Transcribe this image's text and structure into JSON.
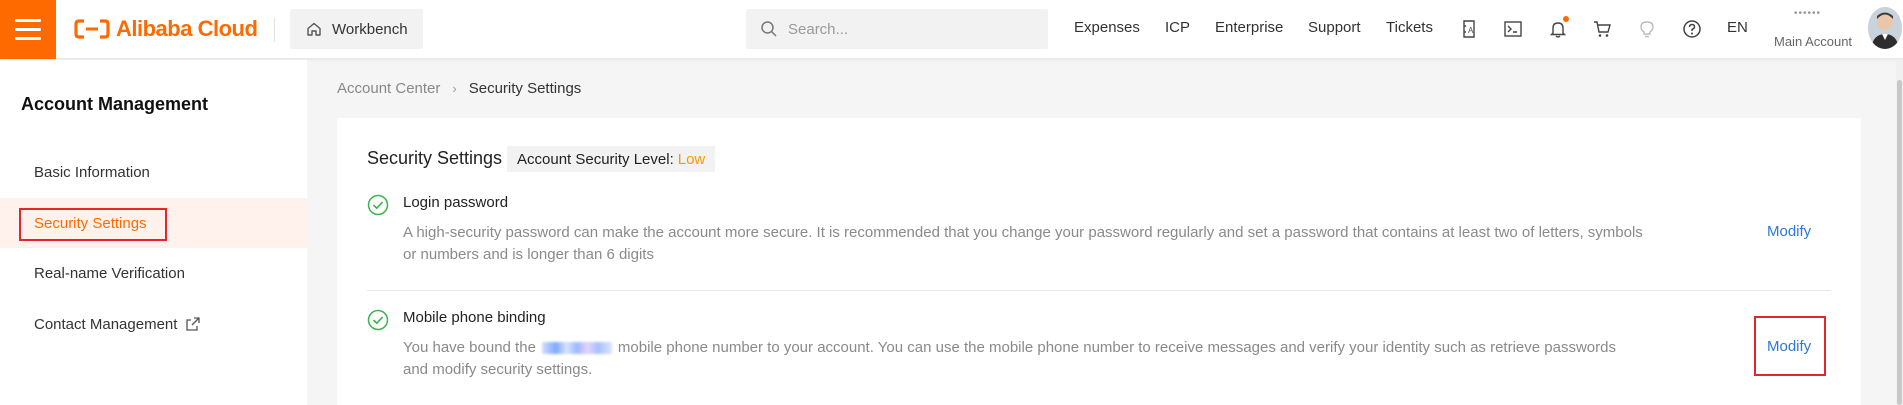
{
  "header": {
    "logo_text": "Alibaba Cloud",
    "workbench_label": "Workbench",
    "search_placeholder": "Search...",
    "nav": {
      "expenses": "Expenses",
      "icp": "ICP",
      "enterprise": "Enterprise",
      "support": "Support",
      "tickets": "Tickets",
      "language": "EN"
    },
    "icons": [
      "ticket-icon",
      "terminal-icon",
      "bell-icon",
      "cart-icon",
      "lightbulb-icon",
      "help-icon"
    ],
    "account_masked": "••••••",
    "account_role": "Main Account",
    "brand_color": "#ff6a00"
  },
  "sidebar": {
    "title": "Account Management",
    "items": [
      {
        "label": "Basic Information",
        "active": false
      },
      {
        "label": "Security Settings",
        "active": true
      },
      {
        "label": "Real-name Verification",
        "active": false
      },
      {
        "label": "Contact Management",
        "active": false,
        "icon": "external-link-icon"
      }
    ]
  },
  "breadcrumb": {
    "parent": "Account Center",
    "separator": "›",
    "current": "Security Settings"
  },
  "main": {
    "title": "Security Settings",
    "level_label": "Account Security Level:",
    "level_value": "Low",
    "level_color": "#ff9800",
    "items": [
      {
        "title": "Login password",
        "description": "A high-security password can make the account more secure. It is recommended that you change your password regularly and set a password that contains at least two of letters, symbols or numbers and is longer than 6 digits",
        "action": "Modify",
        "status_icon": "check-circle-icon"
      },
      {
        "title": "Mobile phone binding",
        "description_before": "You have bound the",
        "description_after": "mobile phone number to your account. You can use the mobile phone number to receive messages and verify your identity such as retrieve passwords and modify security settings.",
        "action": "Modify",
        "status_icon": "check-circle-icon"
      }
    ]
  },
  "link_color": "#2b7ad8"
}
